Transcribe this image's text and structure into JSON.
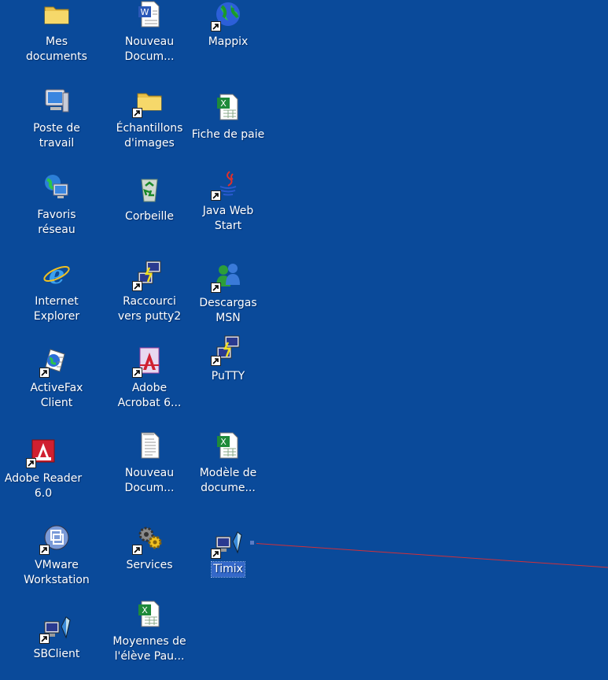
{
  "desktop": {
    "icons": [
      {
        "id": "mes-documents",
        "label": "Mes\ndocuments",
        "icon": "folder-icon",
        "shortcut": false
      },
      {
        "id": "nouveau-doc-word",
        "label": "Nouveau\nDocum...",
        "icon": "word-document-icon",
        "shortcut": false
      },
      {
        "id": "mappix",
        "label": "Mappix",
        "icon": "globe-icon",
        "shortcut": true
      },
      {
        "id": "poste-de-travail",
        "label": "Poste de\ntravail",
        "icon": "computer-icon",
        "shortcut": false
      },
      {
        "id": "echantillons-images",
        "label": "Échantillons\nd'images",
        "icon": "folder-icon",
        "shortcut": true
      },
      {
        "id": "fiche-de-paie",
        "label": "Fiche de paie",
        "icon": "excel-icon",
        "shortcut": false
      },
      {
        "id": "favoris-reseau",
        "label": "Favoris\nréseau",
        "icon": "network-icon",
        "shortcut": false
      },
      {
        "id": "corbeille",
        "label": "Corbeille",
        "icon": "recycle-bin-icon",
        "shortcut": false
      },
      {
        "id": "java-web-start",
        "label": "Java Web\nStart",
        "icon": "java-icon",
        "shortcut": true
      },
      {
        "id": "internet-explorer",
        "label": "Internet\nExplorer",
        "icon": "internet-explorer-icon",
        "shortcut": false
      },
      {
        "id": "raccourci-putty2",
        "label": "Raccourci\nvers putty2",
        "icon": "putty-icon",
        "shortcut": true
      },
      {
        "id": "descargas-msn",
        "label": "Descargas\nMSN",
        "icon": "msn-icon",
        "shortcut": true
      },
      {
        "id": "activefax",
        "label": "ActiveFax\nClient",
        "icon": "fax-icon",
        "shortcut": true
      },
      {
        "id": "adobe-acrobat",
        "label": "Adobe\nAcrobat 6...",
        "icon": "acrobat-icon",
        "shortcut": true
      },
      {
        "id": "putty",
        "label": "PuTTY",
        "icon": "putty-icon",
        "shortcut": true
      },
      {
        "id": "adobe-reader",
        "label": "Adobe Reader\n6.0",
        "icon": "adobe-reader-icon",
        "shortcut": true
      },
      {
        "id": "nouveau-doc-texte",
        "label": "Nouveau\nDocum...",
        "icon": "text-document-icon",
        "shortcut": false
      },
      {
        "id": "modele-document",
        "label": "Modèle de\ndocume...",
        "icon": "excel-icon",
        "shortcut": false
      },
      {
        "id": "vmware",
        "label": "VMware\nWorkstation",
        "icon": "vmware-icon",
        "shortcut": true
      },
      {
        "id": "services",
        "label": "Services",
        "icon": "services-gear-icon",
        "shortcut": true
      },
      {
        "id": "timix",
        "label": "Timix",
        "icon": "network-client-icon",
        "shortcut": true,
        "selected": true
      },
      {
        "id": "sbclient",
        "label": "SBClient",
        "icon": "network-client-icon",
        "shortcut": true
      },
      {
        "id": "moyennes",
        "label": "Moyennes de\nl'élève Pau...",
        "icon": "excel-icon",
        "shortcut": false
      }
    ]
  },
  "colors": {
    "background": "#0a4a9a",
    "selection": "#3468c9",
    "annotation_line": "#d0303a"
  }
}
